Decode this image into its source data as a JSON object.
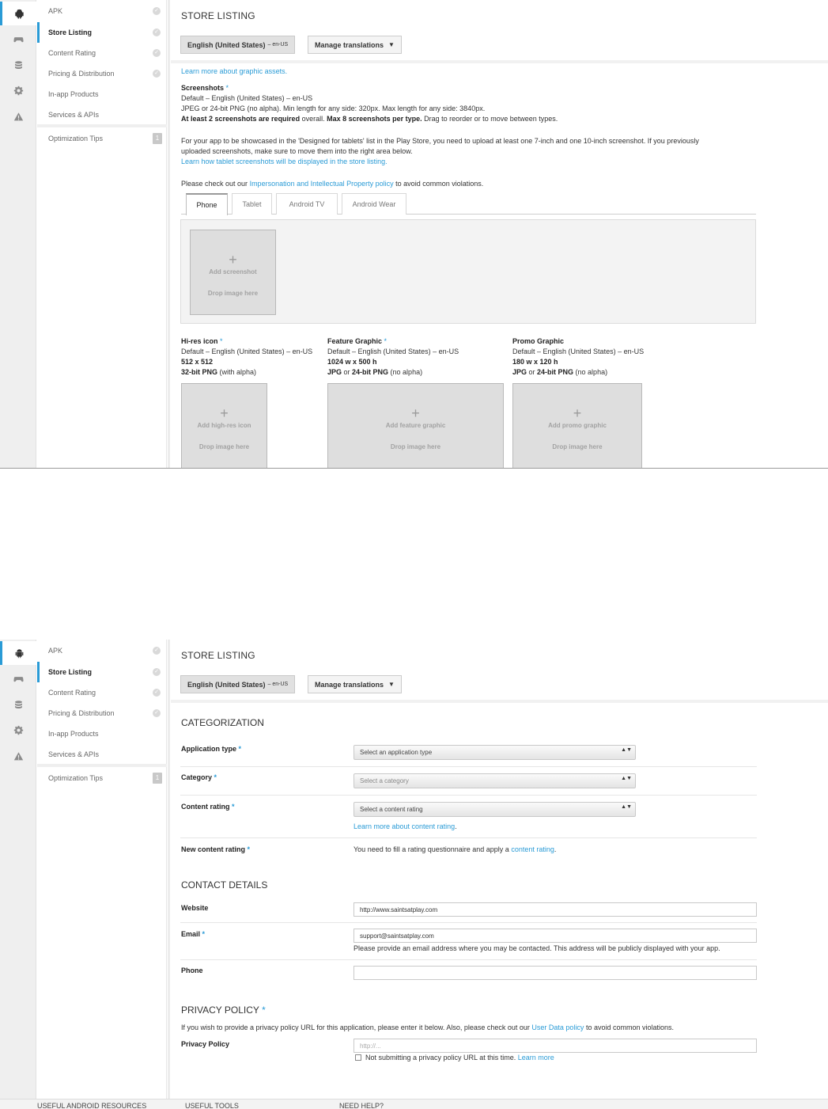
{
  "rail": {
    "icons": [
      "android-icon",
      "gamepad-icon",
      "database-icon",
      "gear-icon",
      "warning-icon"
    ]
  },
  "nav": {
    "items": [
      {
        "label": "APK"
      },
      {
        "label": "Store Listing"
      },
      {
        "label": "Content Rating"
      },
      {
        "label": "Pricing & Distribution"
      },
      {
        "label": "In-app Products"
      },
      {
        "label": "Services & APIs"
      }
    ],
    "check_glyph": "✓",
    "tips_label": "Optimization Tips",
    "tips_badge": "1"
  },
  "header": {
    "title": "STORE LISTING",
    "language_label": "English (United States)",
    "language_code": "– en-US",
    "manage_label": "Manage translations",
    "manage_caret": "▼"
  },
  "graphics": {
    "learn_assets": "Learn more about graphic assets.",
    "screenshots": {
      "title": "Screenshots",
      "req": "*",
      "line1": "Default – English (United States) – en-US",
      "line2": "JPEG or 24-bit PNG (no alpha). Min length for any side: 320px. Max length for any side: 3840px.",
      "line3_a": "At least 2 screenshots are required",
      "line3_b": " overall. ",
      "line3_c": "Max 8 screenshots per type.",
      "line3_d": " Drag to reorder or to move between types."
    },
    "tablet_line1": "For your app to be showcased in the 'Designed for tablets' list in the Play Store, you need to upload at least one 7-inch and one 10-inch screenshot. If you previously",
    "tablet_line2": "uploaded screenshots, make sure to move them into the right area below.",
    "tablet_link": "Learn how tablet screenshots will be displayed in the store listing.",
    "policy_pre": "Please check out our ",
    "policy_link": "Impersonation and Intellectual Property policy",
    "policy_post": " to avoid common violations.",
    "tabs": [
      "Phone",
      "Tablet",
      "Android TV",
      "Android Wear"
    ],
    "plus": "+",
    "add_screenshot": "Add screenshot",
    "drop_here": "Drop image here",
    "hires": {
      "title": "Hi-res icon",
      "req": "*",
      "locale": "Default – English (United States) – en-US",
      "size": "512 x 512",
      "fmt_a": "32-bit PNG",
      "fmt_b": " (with alpha)",
      "add": "Add high-res icon"
    },
    "feature": {
      "title": "Feature Graphic",
      "req": "*",
      "locale": "Default – English (United States) – en-US",
      "size": "1024 w x 500 h",
      "fmt_a": "JPG",
      "fmt_b": " or ",
      "fmt_c": "24-bit PNG",
      "fmt_d": " (no alpha)",
      "add": "Add feature graphic"
    },
    "promo": {
      "title": "Promo Graphic",
      "locale": "Default – English (United States) – en-US",
      "size": "180 w x 120 h",
      "fmt_a": "JPG",
      "fmt_b": " or ",
      "fmt_c": "24-bit PNG",
      "fmt_d": " (no alpha)",
      "add": "Add promo graphic"
    }
  },
  "categorization": {
    "title": "CATEGORIZATION",
    "app_type_label": "Application type",
    "app_type_value": "Select an application type",
    "category_label": "Category",
    "category_value": "Select a category",
    "content_rating_label": "Content rating",
    "content_rating_value": "Select a content rating",
    "learn_pre": "Learn more about ",
    "learn_link": "content rating",
    "learn_post": ".",
    "new_rating_label": "New content rating",
    "new_rating_pre": "You need to fill a rating questionnaire and apply a ",
    "new_rating_link": "content rating",
    "new_rating_post": ".",
    "req": "*",
    "select_arrows": "▲▼"
  },
  "contact": {
    "title": "CONTACT DETAILS",
    "website_label": "Website",
    "website_value": "http://www.saintsatplay.com",
    "email_label": "Email",
    "email_req": "*",
    "email_value": "support@saintsatplay.com",
    "email_help": "Please provide an email address where you may be contacted. This address will be publicly displayed with your app.",
    "phone_label": "Phone",
    "phone_value": ""
  },
  "privacy": {
    "title": "PRIVACY POLICY",
    "req": "*",
    "desc_pre": "If you wish to provide a privacy policy URL for this application, please enter it below. Also, please check out our ",
    "desc_link": "User Data policy",
    "desc_post": " to avoid common violations.",
    "label": "Privacy Policy",
    "placeholder": "http://...",
    "checkbox_label": "Not submitting a privacy policy URL at this time.",
    "learn_more": "Learn more"
  },
  "footer": {
    "col1": "USEFUL ANDROID RESOURCES",
    "col2": "USEFUL TOOLS",
    "col3": "NEED HELP?"
  },
  "colors": {
    "accent": "#2a9bd6",
    "drop_fill": "#dedede",
    "rail_bg": "#efefef"
  }
}
